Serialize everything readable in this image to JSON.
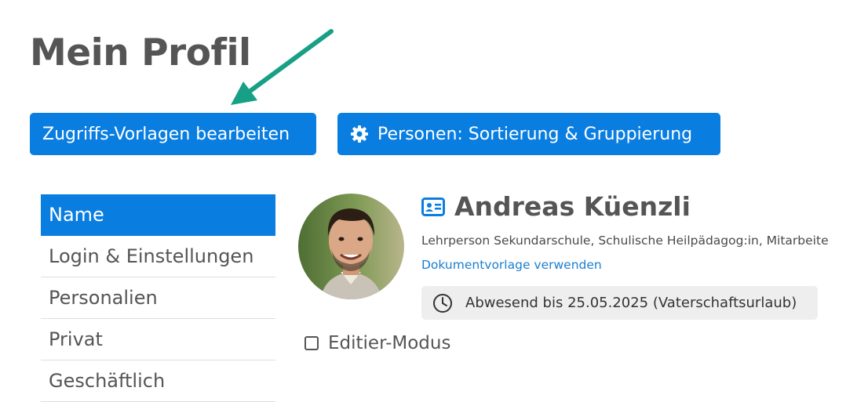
{
  "page": {
    "title": "Mein Profil"
  },
  "toolbar": {
    "templates_label": "Zugriffs-Vorlagen bearbeiten",
    "sorting_label": "Personen: Sortierung & Gruppierung",
    "sorting_icon": "gear-icon"
  },
  "sidebar": {
    "items": [
      {
        "label": "Name",
        "active": true
      },
      {
        "label": "Login & Einstellungen",
        "active": false
      },
      {
        "label": "Personalien",
        "active": false
      },
      {
        "label": "Privat",
        "active": false
      },
      {
        "label": "Geschäftlich",
        "active": false
      }
    ]
  },
  "profile": {
    "name": "Andreas Küenzli",
    "name_icon": "id-card-icon",
    "roles": "Lehrperson Sekundarschule, Schulische Heilpädagog:in, Mitarbeite",
    "doc_link": "Dokumentvorlage verwenden",
    "absence": "Abwesend bis 25.05.2025 (Vaterschaftsurlaub)",
    "absence_icon": "clock-icon"
  },
  "edit_mode": {
    "label": "Editier-Modus",
    "checked": false
  },
  "colors": {
    "primary": "#0a7ee0",
    "annotation_arrow": "#17a085",
    "badge_bg": "#eeeeee"
  }
}
